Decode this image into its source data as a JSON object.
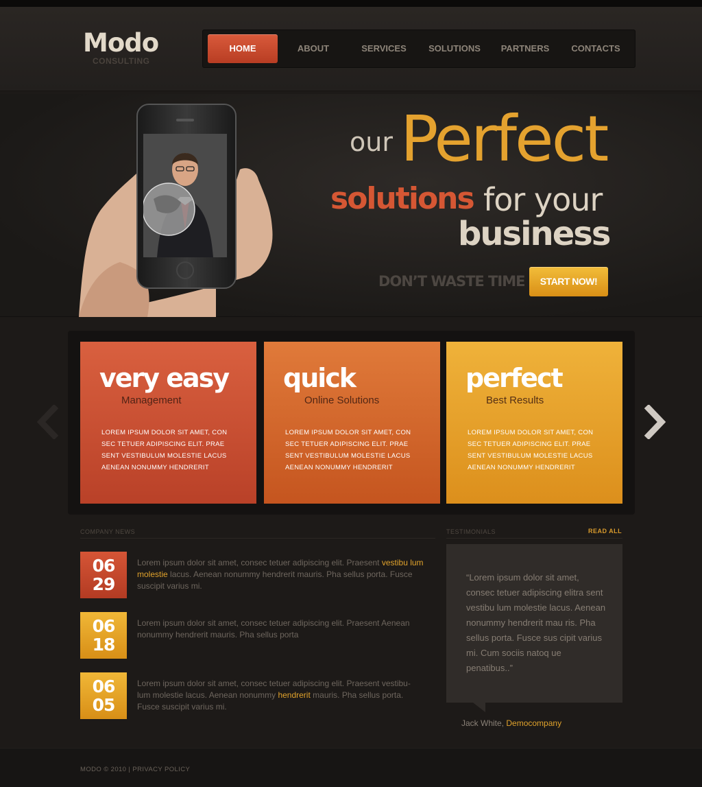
{
  "brand": {
    "name": "Modo",
    "tagline": "CONSULTING"
  },
  "nav": {
    "items": [
      {
        "label": "HOME"
      },
      {
        "label": "ABOUT"
      },
      {
        "label": "SERVICES"
      },
      {
        "label": "SOLUTIONS"
      },
      {
        "label": "PARTNERS"
      },
      {
        "label": "CONTACTS"
      }
    ],
    "active": "HOME"
  },
  "hero": {
    "our": "our",
    "perfect": "Perfect",
    "solutions": "solutions",
    "for_your": "for your",
    "business": "business",
    "dont_waste": "DON’T WASTE TIME",
    "cta": "START NOW!"
  },
  "features": [
    {
      "title": "very easy",
      "subtitle": "Management",
      "text": "LOREM IPSUM DOLOR SIT AMET, CON SEC TETUER ADIPISCING ELIT. PRAE SENT VESTIBULUM MOLESTIE LACUS AENEAN NONUMMY HENDRERIT"
    },
    {
      "title": "quick",
      "subtitle": "Online Solutions",
      "text": "LOREM IPSUM DOLOR SIT AMET, CON SEC TETUER ADIPISCING ELIT. PRAE SENT VESTIBULUM MOLESTIE LACUS AENEAN NONUMMY HENDRERIT"
    },
    {
      "title": "perfect",
      "subtitle": "Best Results",
      "text": "LOREM IPSUM DOLOR SIT AMET, CON SEC TETUER ADIPISCING ELIT. PRAE SENT VESTIBULUM MOLESTIE LACUS AENEAN NONUMMY HENDRERIT"
    }
  ],
  "news": {
    "label": "COMPANY NEWS",
    "items": [
      {
        "month": "06",
        "day": "29",
        "pre": "Lorem ipsum dolor sit amet, consec tetuer adipiscing elit. Praesent ",
        "highlight": "vestibu lum molestie",
        "post": " lacus. Aenean nonummy hendrerit mauris. Pha sellus porta. Fusce suscipit varius mi."
      },
      {
        "month": "06",
        "day": "18",
        "pre": "Lorem ipsum dolor sit amet, consec tetuer adipiscing elit. Praesent Aenean nonummy hendrerit mauris. Pha sellus porta",
        "highlight": "",
        "post": ""
      },
      {
        "month": "06",
        "day": "05",
        "pre": "Lorem ipsum dolor sit amet, consec tetuer adipiscing elit. Praesent vestibu- lum molestie lacus. Aenean nonummy ",
        "highlight": "hendrerit",
        "post": " mauris. Pha sellus porta. Fusce suscipit varius mi."
      }
    ]
  },
  "testimonials": {
    "label": "TESTIMONIALS",
    "read_all": "READ ALL",
    "quote": "“Lorem ipsum dolor sit amet, consec tetuer adipiscing elitra sent vestibu lum molestie lacus. Aenean nonummy hendrerit mau ris. Pha sellus porta. Fusce sus cipit varius mi. Cum sociis natoq ue penatibus..”",
    "author": "Jack White",
    "sep": ",",
    "company": "Democompany"
  },
  "footer": {
    "copyright": "MODO © 2010",
    "sep": "|",
    "privacy": "PRIVACY POLICY"
  },
  "colors": {
    "accent_red": "#d55734",
    "accent_orange": "#e07a3a",
    "accent_yellow": "#e4a22f",
    "background": "#1d1a18"
  }
}
